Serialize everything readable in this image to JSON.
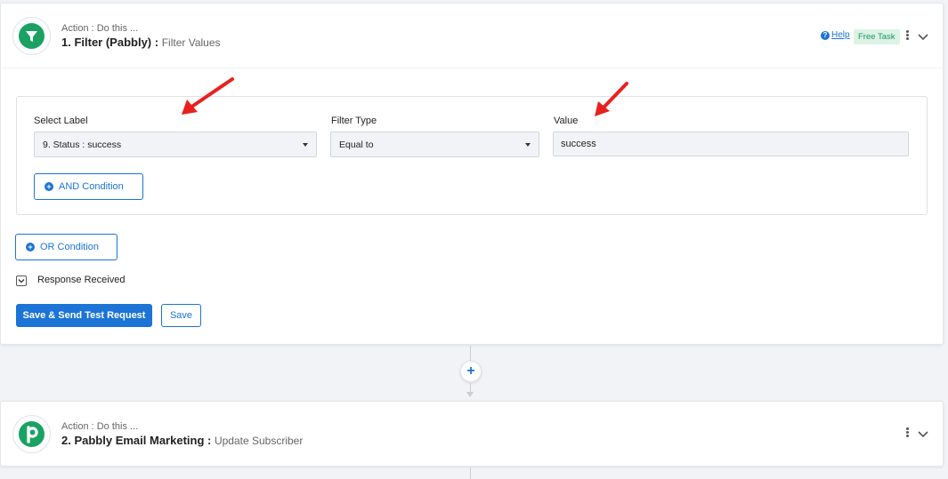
{
  "colors": {
    "accent": "#1b74d6",
    "brand_green": "#1aa263",
    "arrow_red": "#e8211e",
    "badge_bg": "#dcf3e6"
  },
  "step1": {
    "subtitle": "Action : Do this ...",
    "title_app": "1. Filter (Pabbly) :",
    "title_event": "Filter Values",
    "logo_icon": "funnel-icon",
    "help_label": "Help",
    "badge": "Free Task",
    "filter": {
      "select_label": "Select Label",
      "select_value": "9. Status : success",
      "filter_type_label": "Filter Type",
      "filter_type_value": "Equal to",
      "value_label": "Value",
      "value_value": "success",
      "and_condition": "AND Condition"
    },
    "or_condition": "OR Condition",
    "response_label": "Response Received",
    "save_test_label": "Save & Send Test Request",
    "save_label": "Save"
  },
  "connector": {
    "add_symbol": "+"
  },
  "step2": {
    "subtitle": "Action : Do this ...",
    "title_app": "2. Pabbly Email Marketing :",
    "title_event": "Update Subscriber",
    "logo_icon": "pabbly-p-icon"
  }
}
